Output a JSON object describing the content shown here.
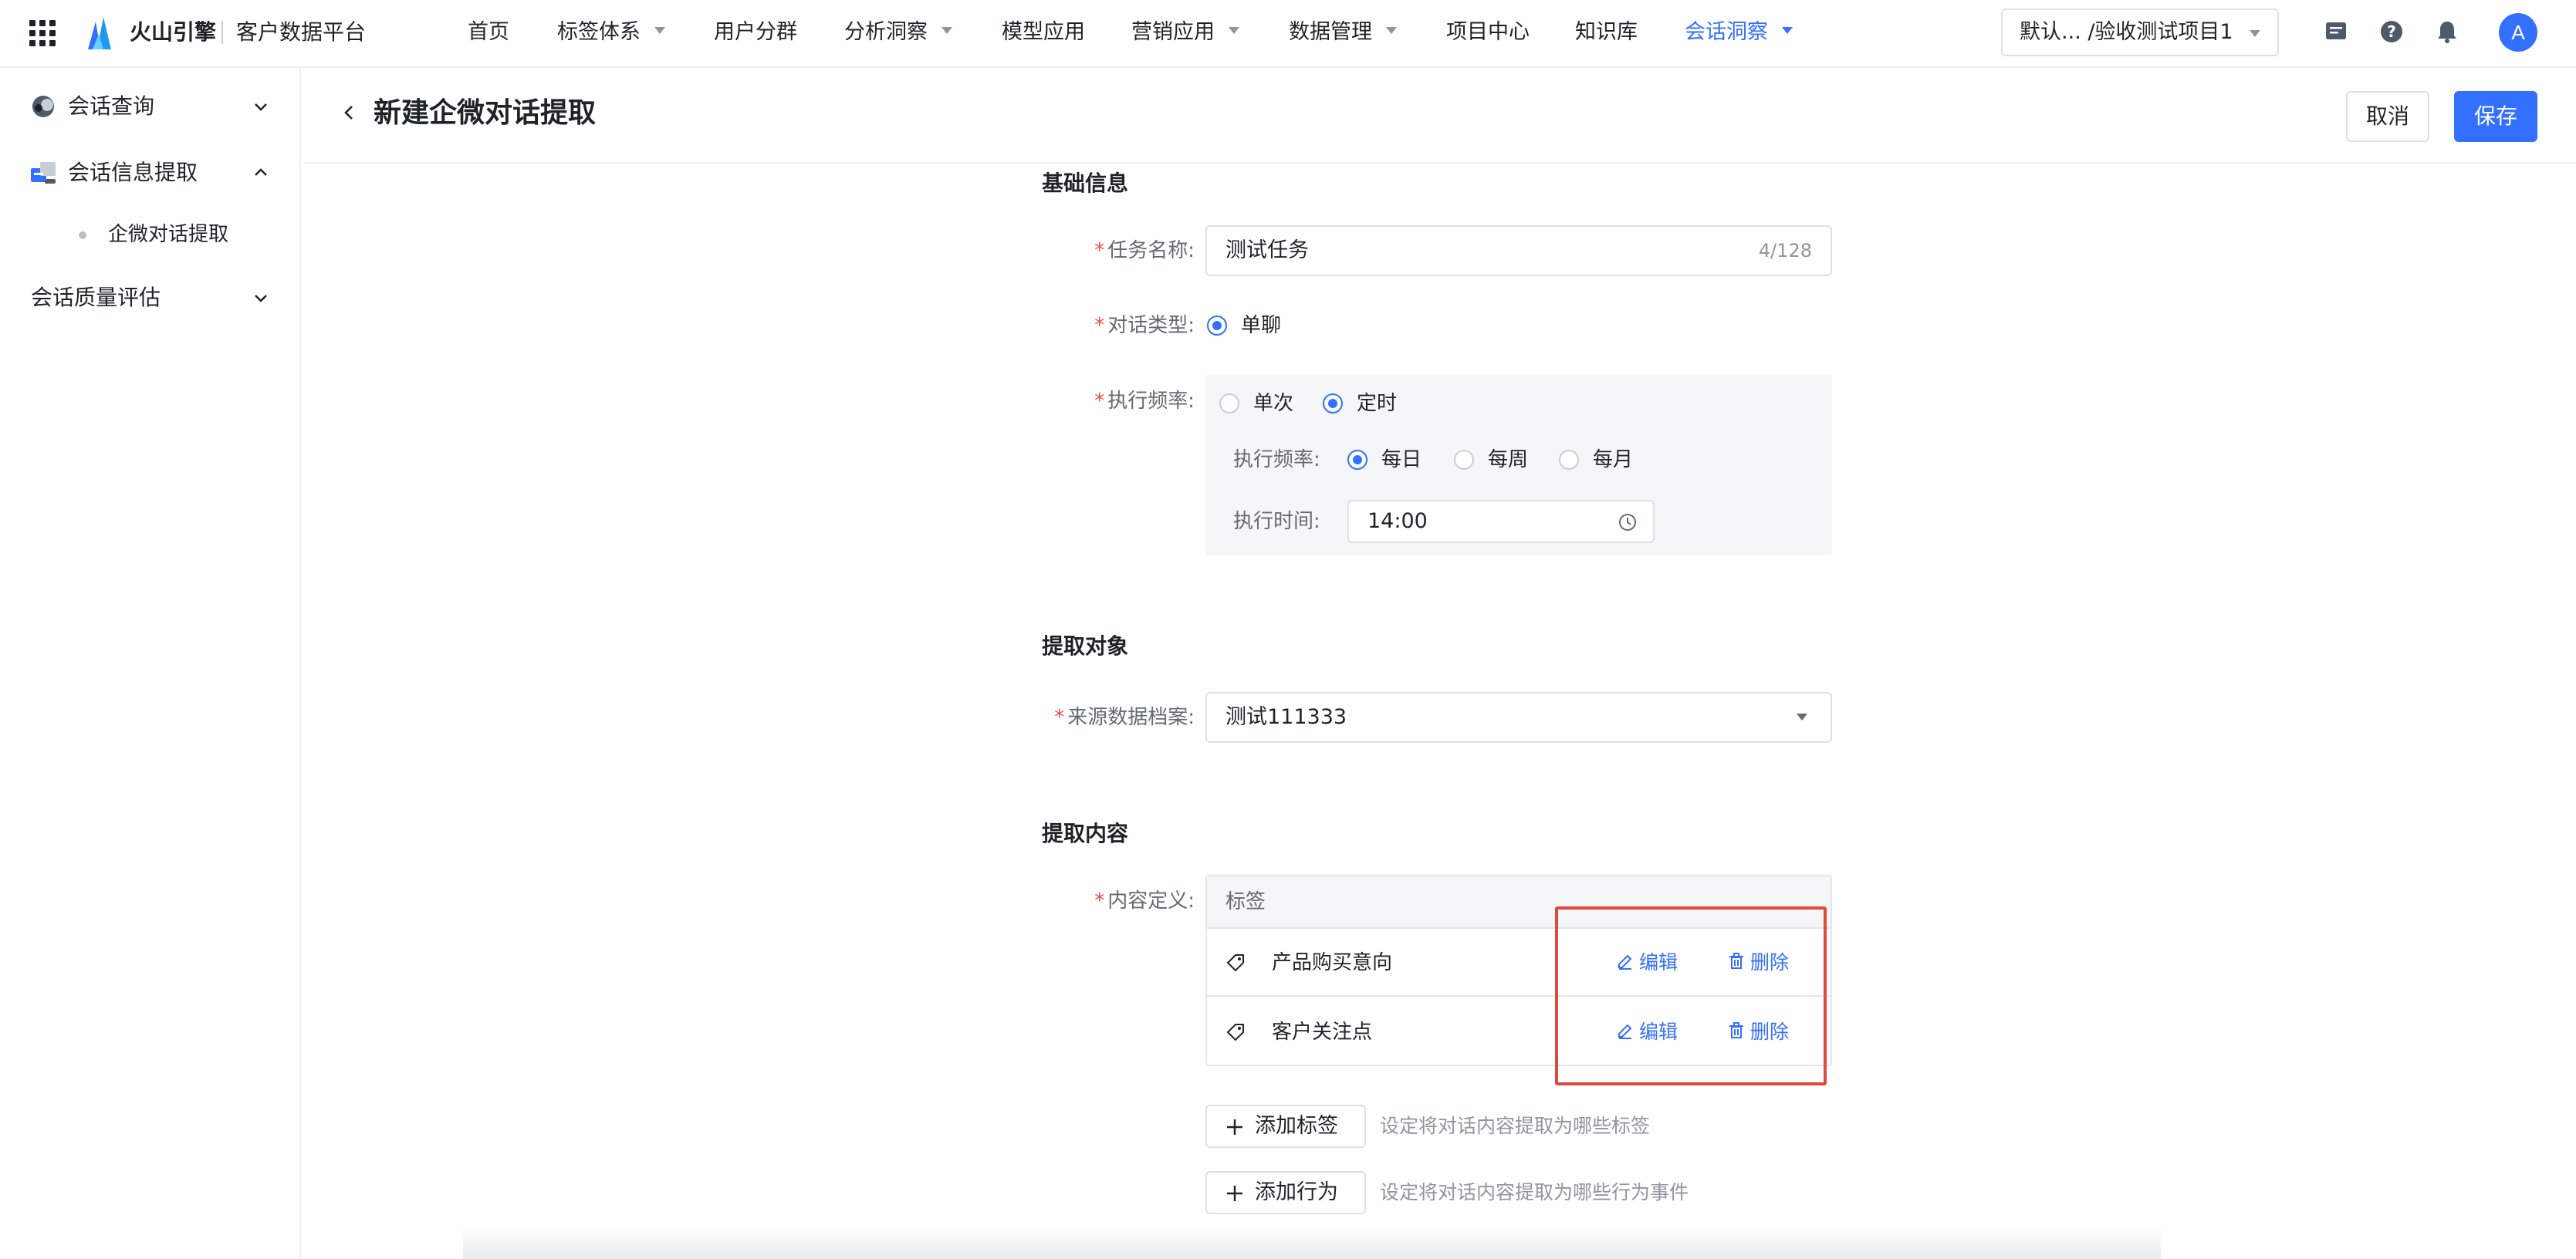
{
  "topbar": {
    "brand": "火山引擎",
    "product": "客户数据平台",
    "nav": [
      {
        "label": "首页",
        "dropdown": false,
        "active": false
      },
      {
        "label": "标签体系",
        "dropdown": true,
        "active": false
      },
      {
        "label": "用户分群",
        "dropdown": false,
        "active": false
      },
      {
        "label": "分析洞察",
        "dropdown": true,
        "active": false
      },
      {
        "label": "模型应用",
        "dropdown": false,
        "active": false
      },
      {
        "label": "营销应用",
        "dropdown": true,
        "active": false
      },
      {
        "label": "数据管理",
        "dropdown": true,
        "active": false
      },
      {
        "label": "项目中心",
        "dropdown": false,
        "active": false
      },
      {
        "label": "知识库",
        "dropdown": false,
        "active": false
      },
      {
        "label": "会话洞察",
        "dropdown": true,
        "active": true
      }
    ],
    "project_selector": "默认...   /验收测试项目1",
    "avatar_initial": "A",
    "icons": [
      "message-icon",
      "help-icon",
      "bell-icon"
    ]
  },
  "sidebar": {
    "items": [
      {
        "label": "会话查询",
        "expanded": false
      },
      {
        "label": "会话信息提取",
        "expanded": true,
        "children": [
          {
            "label": "企微对话提取",
            "active": true
          }
        ]
      },
      {
        "label": "会话质量评估",
        "expanded": false
      }
    ]
  },
  "page": {
    "title": "新建企微对话提取",
    "cancel_label": "取消",
    "save_label": "保存"
  },
  "form": {
    "basic": {
      "section_title": "基础信息",
      "task_name_label": "任务名称:",
      "task_name_value": "测试任务",
      "task_name_count": "4/128",
      "dialog_type_label": "对话类型:",
      "dialog_type_option": "单聊",
      "frequency_label": "执行频率:",
      "frequency_options": [
        "单次",
        "定时"
      ],
      "frequency_selected": "定时",
      "schedule": {
        "frequency_label": "执行频率:",
        "options": [
          "每日",
          "每周",
          "每月"
        ],
        "selected": "每日",
        "time_label": "执行时间:",
        "time_value": "14:00"
      }
    },
    "target": {
      "section_title": "提取对象",
      "source_label": "来源数据档案:",
      "source_value": "测试111333"
    },
    "content": {
      "section_title": "提取内容",
      "definition_label": "内容定义:",
      "table_header": "标签",
      "rows": [
        {
          "name": "产品购买意向",
          "edit": "编辑",
          "delete": "删除"
        },
        {
          "name": "客户关注点",
          "edit": "编辑",
          "delete": "删除"
        }
      ],
      "add_tag_label": "添加标签",
      "add_tag_hint": "设定将对话内容提取为哪些标签",
      "add_behavior_label": "添加行为",
      "add_behavior_hint": "设定将对话内容提取为哪些行为事件"
    }
  },
  "colors": {
    "accent": "#3370ff",
    "required": "#f54a45",
    "highlight": "#e2483d"
  }
}
